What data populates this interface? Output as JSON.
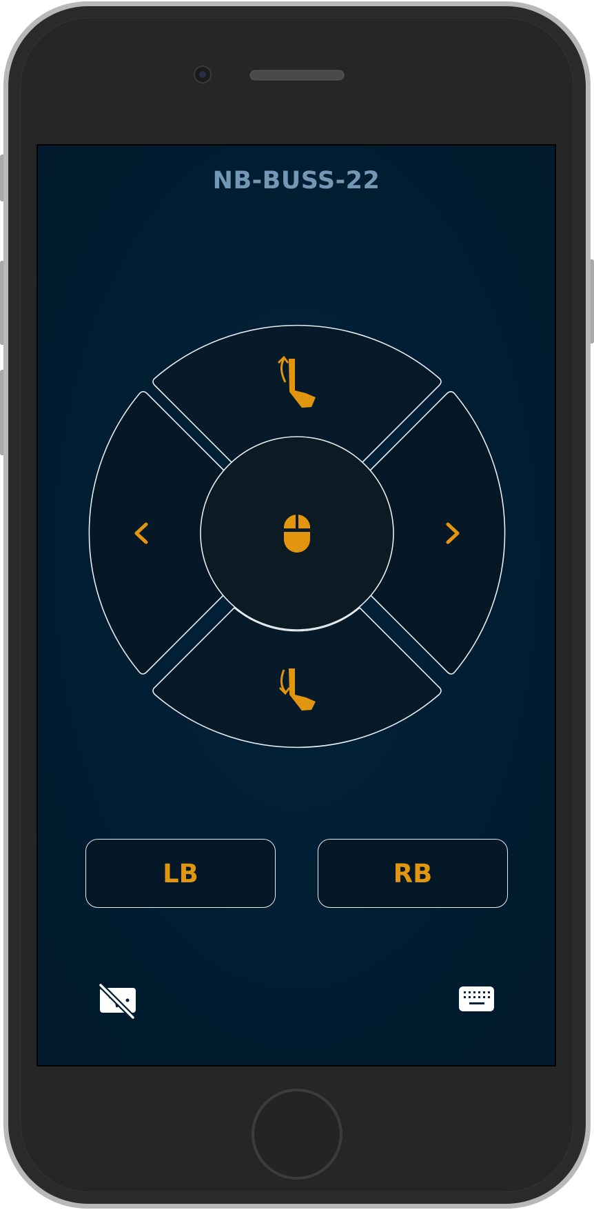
{
  "device": {
    "name": "NB-BUSS-22"
  },
  "dpad": {
    "up_icon": "scroll-up-hand-icon",
    "down_icon": "scroll-down-hand-icon",
    "left_icon": "chevron-left-icon",
    "right_icon": "chevron-right-icon",
    "center_icon": "mouse-icon"
  },
  "buttons": {
    "left": "LB",
    "right": "RB"
  },
  "toolbar": {
    "left_icon": "screen-off-icon",
    "right_icon": "keyboard-icon"
  },
  "colors": {
    "accent": "#e2950f",
    "background": "#011e33",
    "title": "#7497b6",
    "outline": "#e9eef3"
  }
}
